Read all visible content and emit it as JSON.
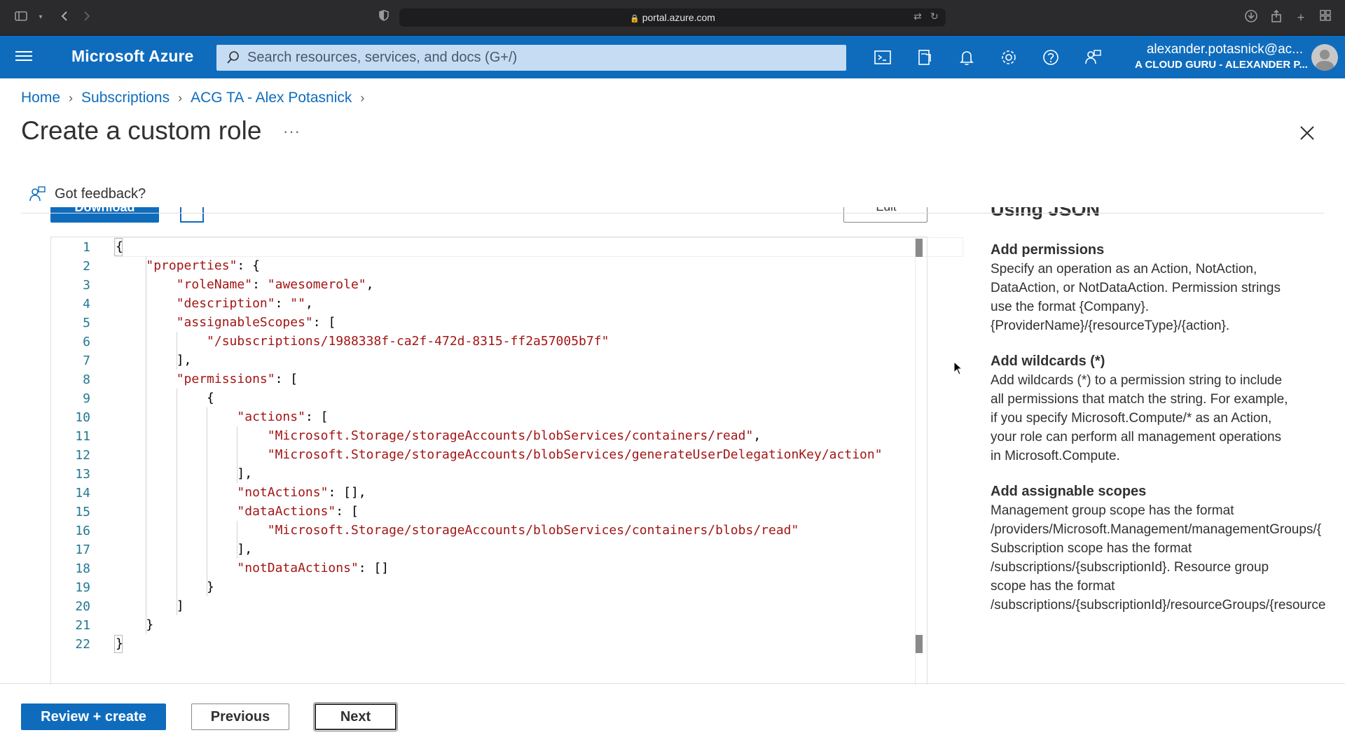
{
  "browser": {
    "url": "portal.azure.com"
  },
  "azure": {
    "brand": "Microsoft Azure",
    "search_placeholder": "Search resources, services, and docs (G+/)",
    "user_name": "alexander.potasnick@ac...",
    "user_tenant": "A CLOUD GURU - ALEXANDER P..."
  },
  "breadcrumb": [
    "Home",
    "Subscriptions",
    "ACG TA - Alex Potasnick"
  ],
  "page": {
    "title": "Create a custom role",
    "more": "···",
    "feedback": "Got feedback?"
  },
  "toolbar": {
    "download_label": "Download",
    "edit_label": "Edit",
    "section_heading": "Using JSON"
  },
  "editor": {
    "line_numbers": [
      "1",
      "2",
      "3",
      "4",
      "5",
      "6",
      "7",
      "8",
      "9",
      "10",
      "11",
      "12",
      "13",
      "14",
      "15",
      "16",
      "17",
      "18",
      "19",
      "20",
      "21",
      "22"
    ],
    "lines": [
      "{",
      "    \"properties\": {",
      "        \"roleName\": \"awesomerole\",",
      "        \"description\": \"\",",
      "        \"assignableScopes\": [",
      "            \"/subscriptions/1988338f-ca2f-472d-8315-ff2a57005b7f\"",
      "        ],",
      "        \"permissions\": [",
      "            {",
      "                \"actions\": [",
      "                    \"Microsoft.Storage/storageAccounts/blobServices/containers/read\",",
      "                    \"Microsoft.Storage/storageAccounts/blobServices/generateUserDelegationKey/action\"",
      "                ],",
      "                \"notActions\": [],",
      "                \"dataActions\": [",
      "                    \"Microsoft.Storage/storageAccounts/blobServices/containers/blobs/read\"",
      "                ],",
      "                \"notDataActions\": []",
      "            }",
      "        ]",
      "    }",
      "}"
    ]
  },
  "info": {
    "sections": [
      {
        "heading": "Add permissions",
        "lines": [
          "Specify an operation as an Action, NotAction,",
          "DataAction, or NotDataAction. Permission strings",
          "use the format {Company}.",
          "{ProviderName}/{resourceType}/{action}."
        ]
      },
      {
        "heading": "Add wildcards (*)",
        "lines": [
          "Add wildcards (*) to a permission string to include",
          "all permissions that match the string. For example,",
          "if you specify Microsoft.Compute/* as an Action,",
          "your role can perform all management operations",
          "in Microsoft.Compute."
        ]
      },
      {
        "heading": "Add assignable scopes",
        "lines": [
          "Management group scope has the format",
          "/providers/Microsoft.Management/managementGroups/{",
          "Subscription scope has the format",
          "/subscriptions/{subscriptionId}. Resource group",
          "scope has the format",
          "/subscriptions/{subscriptionId}/resourceGroups/{resource"
        ]
      }
    ]
  },
  "footer": {
    "review_create": "Review + create",
    "previous": "Previous",
    "next": "Next"
  },
  "colors": {
    "azure_blue": "#0f6cbd",
    "json_key": "#a31515",
    "json_string": "#0451a5",
    "line_number": "#237893"
  }
}
